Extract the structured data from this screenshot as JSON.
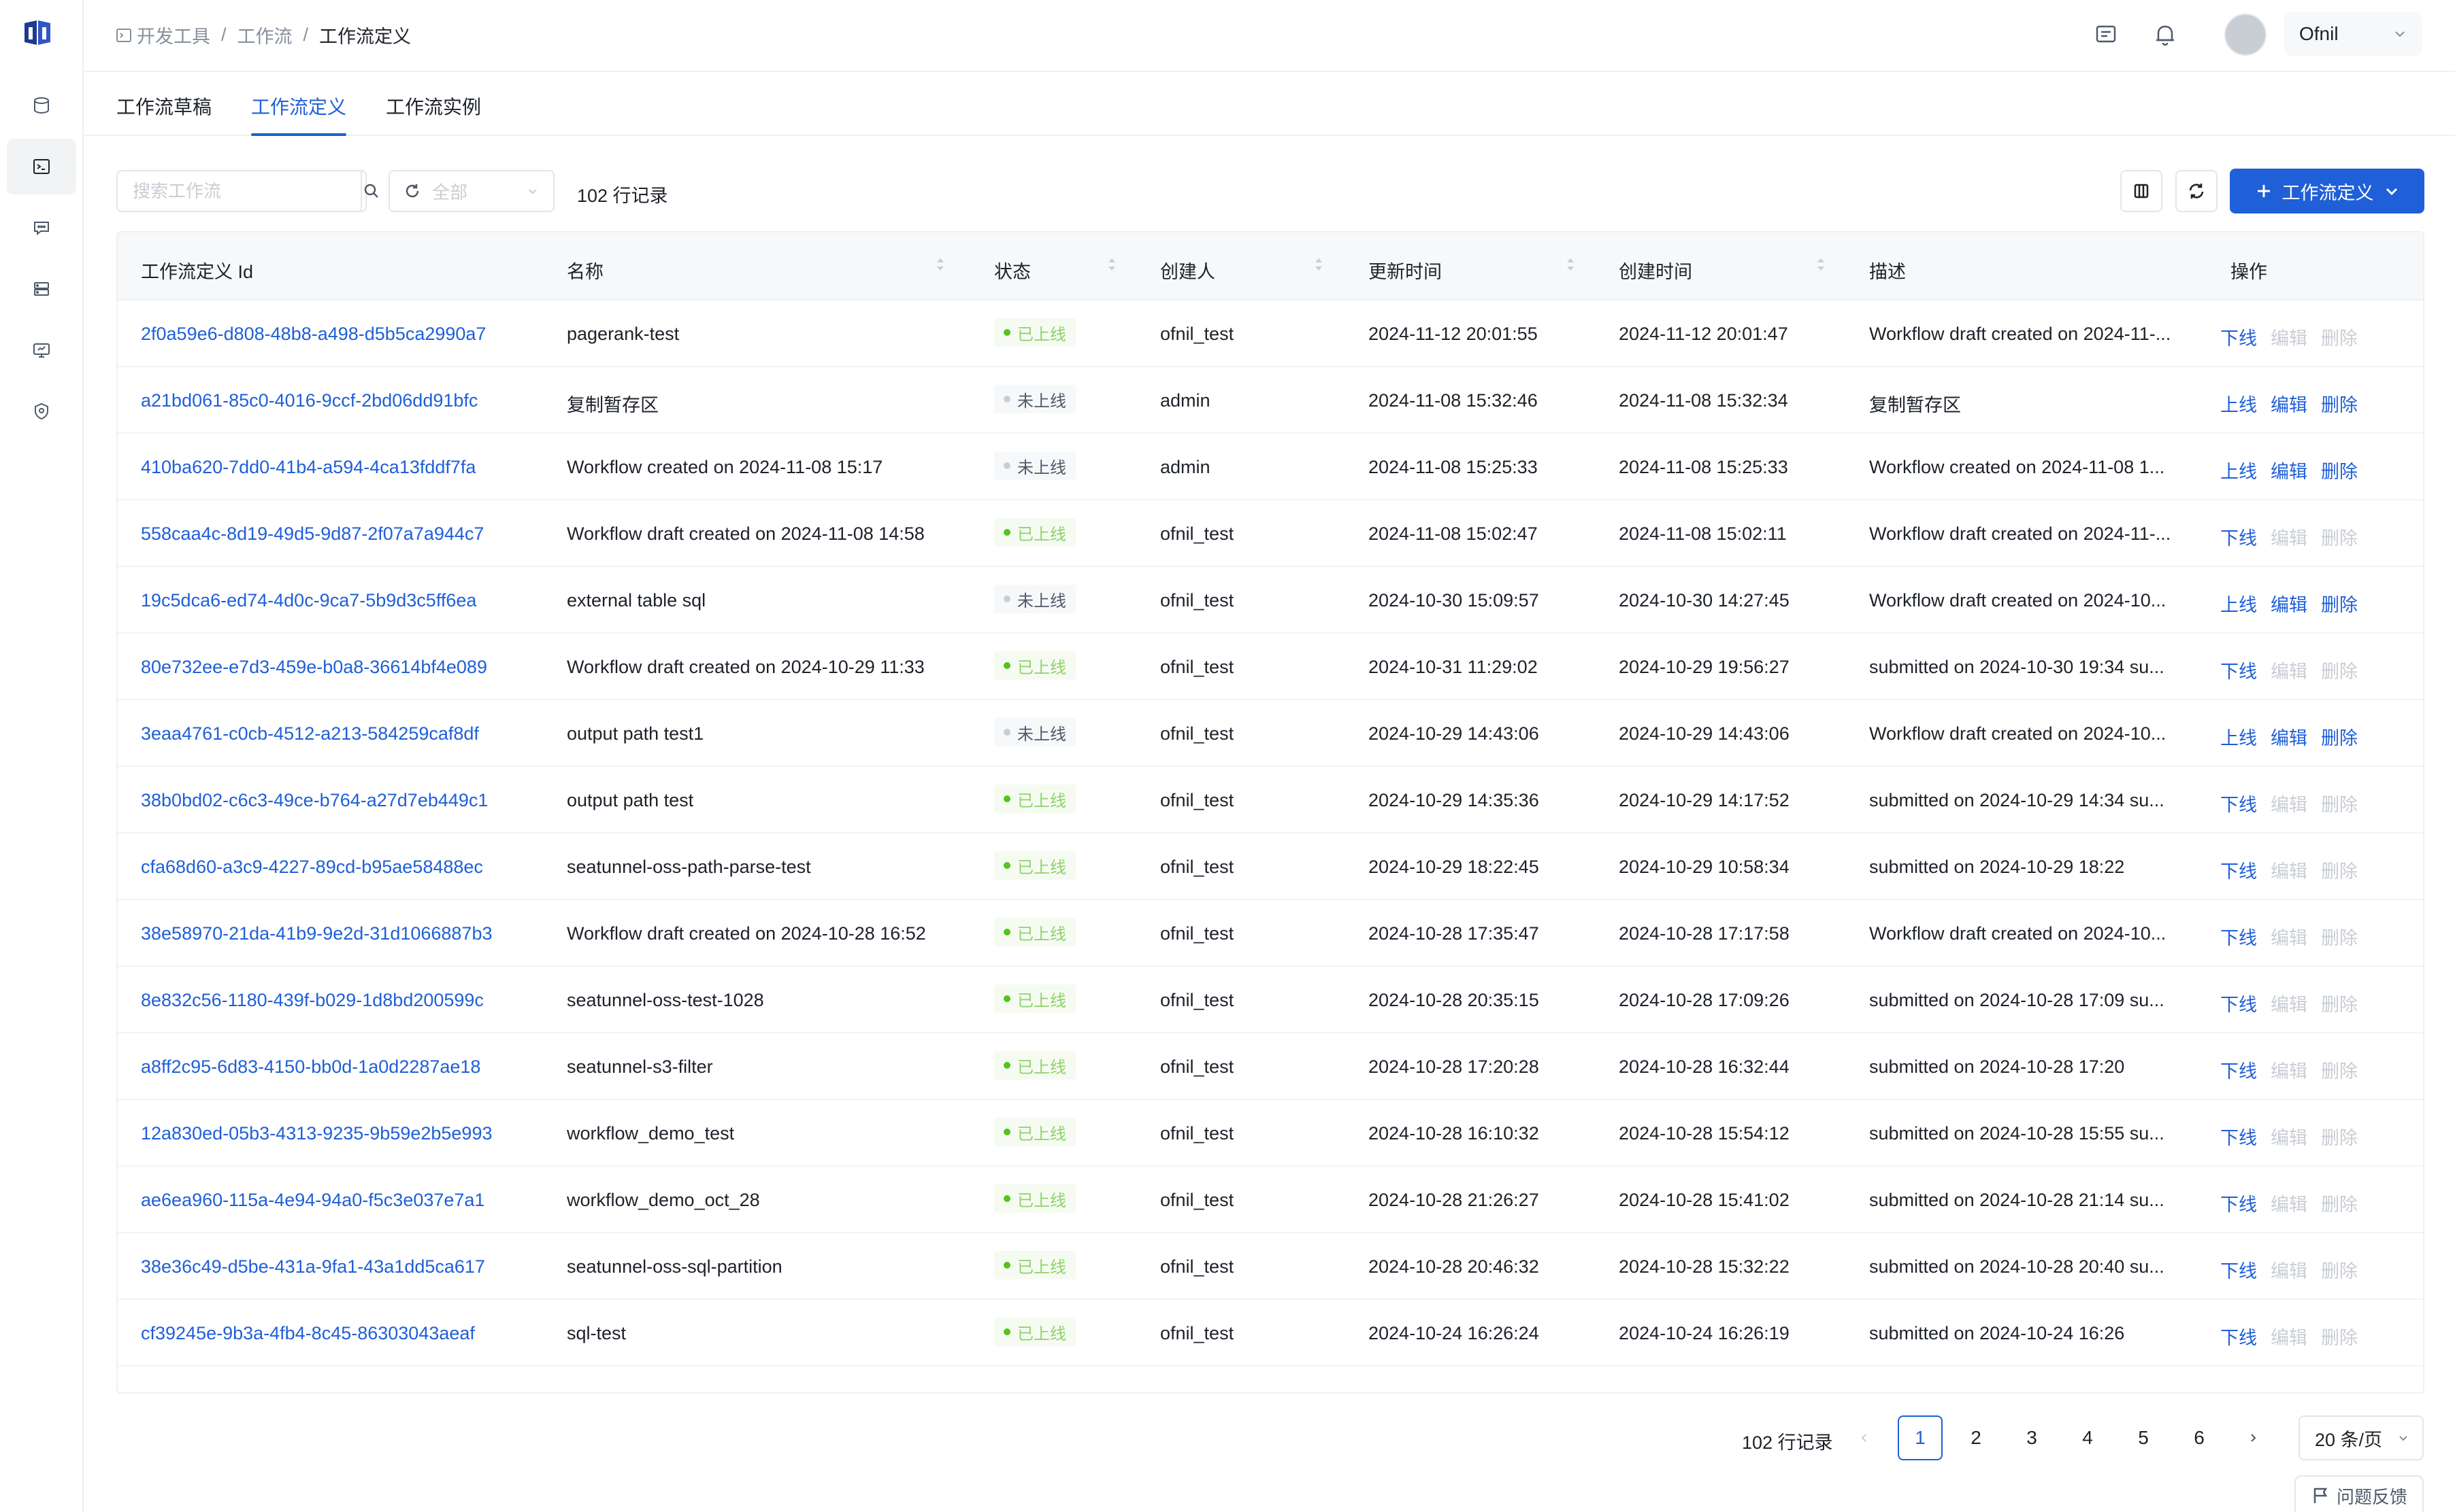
{
  "breadcrumb": [
    "开发工具",
    "工作流",
    "工作流定义"
  ],
  "user": {
    "name": "Ofnil"
  },
  "tabs": [
    {
      "label": "工作流草稿",
      "active": false
    },
    {
      "label": "工作流定义",
      "active": true
    },
    {
      "label": "工作流实例",
      "active": false
    }
  ],
  "toolbar": {
    "search_placeholder": "搜索工作流",
    "status_placeholder": "全部",
    "record_count": "102 行记录",
    "create_label": "工作流定义"
  },
  "columns": [
    {
      "label": "工作流定义 Id",
      "sortable": false
    },
    {
      "label": "名称",
      "sortable": true
    },
    {
      "label": "状态",
      "sortable": true
    },
    {
      "label": "创建人",
      "sortable": true
    },
    {
      "label": "更新时间",
      "sortable": true
    },
    {
      "label": "创建时间",
      "sortable": true
    },
    {
      "label": "描述",
      "sortable": false
    },
    {
      "label": "操作",
      "sortable": false
    }
  ],
  "actions": {
    "online": "上线",
    "offline": "下线",
    "edit": "编辑",
    "delete": "删除"
  },
  "status_labels": {
    "online": "已上线",
    "offline": "未上线"
  },
  "rows": [
    {
      "id": "2f0a59e6-d808-48b8-a498-d5b5ca2990a7",
      "name": "pagerank-test",
      "status": "online",
      "creator": "ofnil_test",
      "updated": "2024-11-12 20:01:55",
      "created": "2024-11-12 20:01:47",
      "desc": "Workflow draft created on 2024-11-..."
    },
    {
      "id": "a21bd061-85c0-4016-9ccf-2bd06dd91bfc",
      "name": "复制暂存区",
      "status": "offline",
      "creator": "admin",
      "updated": "2024-11-08 15:32:46",
      "created": "2024-11-08 15:32:34",
      "desc": "复制暂存区"
    },
    {
      "id": "410ba620-7dd0-41b4-a594-4ca13fddf7fa",
      "name": "Workflow created on 2024-11-08 15:17",
      "status": "offline",
      "creator": "admin",
      "updated": "2024-11-08 15:25:33",
      "created": "2024-11-08 15:25:33",
      "desc": "Workflow created on 2024-11-08 1..."
    },
    {
      "id": "558caa4c-8d19-49d5-9d87-2f07a7a944c7",
      "name": "Workflow draft created on 2024-11-08 14:58",
      "status": "online",
      "creator": "ofnil_test",
      "updated": "2024-11-08 15:02:47",
      "created": "2024-11-08 15:02:11",
      "desc": "Workflow draft created on 2024-11-..."
    },
    {
      "id": "19c5dca6-ed74-4d0c-9ca7-5b9d3c5ff6ea",
      "name": "external table sql",
      "status": "offline",
      "creator": "ofnil_test",
      "updated": "2024-10-30 15:09:57",
      "created": "2024-10-30 14:27:45",
      "desc": "Workflow draft created on 2024-10..."
    },
    {
      "id": "80e732ee-e7d3-459e-b0a8-36614bf4e089",
      "name": "Workflow draft created on 2024-10-29 11:33",
      "status": "online",
      "creator": "ofnil_test",
      "updated": "2024-10-31 11:29:02",
      "created": "2024-10-29 19:56:27",
      "desc": "submitted on 2024-10-30 19:34 su..."
    },
    {
      "id": "3eaa4761-c0cb-4512-a213-584259caf8df",
      "name": "output path test1",
      "status": "offline",
      "creator": "ofnil_test",
      "updated": "2024-10-29 14:43:06",
      "created": "2024-10-29 14:43:06",
      "desc": "Workflow draft created on 2024-10..."
    },
    {
      "id": "38b0bd02-c6c3-49ce-b764-a27d7eb449c1",
      "name": "output path test",
      "status": "online",
      "creator": "ofnil_test",
      "updated": "2024-10-29 14:35:36",
      "created": "2024-10-29 14:17:52",
      "desc": "submitted on 2024-10-29 14:34 su..."
    },
    {
      "id": "cfa68d60-a3c9-4227-89cd-b95ae58488ec",
      "name": "seatunnel-oss-path-parse-test",
      "status": "online",
      "creator": "ofnil_test",
      "updated": "2024-10-29 18:22:45",
      "created": "2024-10-29 10:58:34",
      "desc": "submitted on 2024-10-29 18:22"
    },
    {
      "id": "38e58970-21da-41b9-9e2d-31d1066887b3",
      "name": "Workflow draft created on 2024-10-28 16:52",
      "status": "online",
      "creator": "ofnil_test",
      "updated": "2024-10-28 17:35:47",
      "created": "2024-10-28 17:17:58",
      "desc": "Workflow draft created on 2024-10..."
    },
    {
      "id": "8e832c56-1180-439f-b029-1d8bd200599c",
      "name": "seatunnel-oss-test-1028",
      "status": "online",
      "creator": "ofnil_test",
      "updated": "2024-10-28 20:35:15",
      "created": "2024-10-28 17:09:26",
      "desc": "submitted on 2024-10-28 17:09 su..."
    },
    {
      "id": "a8ff2c95-6d83-4150-bb0d-1a0d2287ae18",
      "name": "seatunnel-s3-filter",
      "status": "online",
      "creator": "ofnil_test",
      "updated": "2024-10-28 17:20:28",
      "created": "2024-10-28 16:32:44",
      "desc": "submitted on 2024-10-28 17:20"
    },
    {
      "id": "12a830ed-05b3-4313-9235-9b59e2b5e993",
      "name": "workflow_demo_test",
      "status": "online",
      "creator": "ofnil_test",
      "updated": "2024-10-28 16:10:32",
      "created": "2024-10-28 15:54:12",
      "desc": "submitted on 2024-10-28 15:55 su..."
    },
    {
      "id": "ae6ea960-115a-4e94-94a0-f5c3e037e7a1",
      "name": "workflow_demo_oct_28",
      "status": "online",
      "creator": "ofnil_test",
      "updated": "2024-10-28 21:26:27",
      "created": "2024-10-28 15:41:02",
      "desc": "submitted on 2024-10-28 21:14 su..."
    },
    {
      "id": "38e36c49-d5be-431a-9fa1-43a1dd5ca617",
      "name": "seatunnel-oss-sql-partition",
      "status": "online",
      "creator": "ofnil_test",
      "updated": "2024-10-28 20:46:32",
      "created": "2024-10-28 15:32:22",
      "desc": "submitted on 2024-10-28 20:40 su..."
    },
    {
      "id": "cf39245e-9b3a-4fb4-8c45-86303043aeaf",
      "name": "sql-test",
      "status": "online",
      "creator": "ofnil_test",
      "updated": "2024-10-24 16:26:24",
      "created": "2024-10-24 16:26:19",
      "desc": "submitted on 2024-10-24 16:26"
    }
  ],
  "pagination": {
    "total": "102 行记录",
    "pages": [
      "1",
      "2",
      "3",
      "4",
      "5",
      "6"
    ],
    "current": "1",
    "page_size": "20 条/页"
  },
  "feedback_label": "问题反馈",
  "colors": {
    "primary": "#1f5fd8",
    "online": "#52c41a",
    "offline": "#c9cdd4"
  }
}
